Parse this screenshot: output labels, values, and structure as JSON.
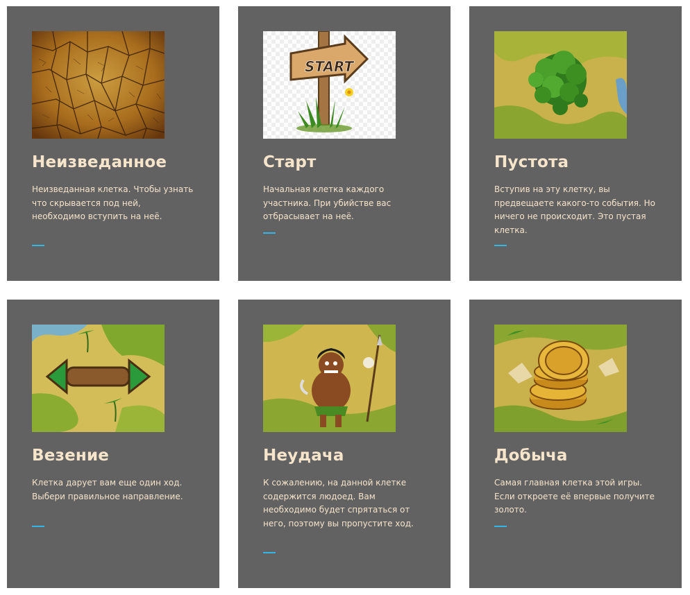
{
  "cards": [
    {
      "title": "Неизведанное",
      "description": "Неизведанная клетка. Чтобы узнать что скрывается под ней, необходимо вступить на неё.",
      "image": "cracked-earth-icon",
      "accent": "#34b7e6"
    },
    {
      "title": "Старт",
      "description": "Начальная клетка каждого участника. При убийстве вас отбрасывает на неё.",
      "image": "start-signpost-icon",
      "sign_text": "START",
      "accent": "#34b7e6"
    },
    {
      "title": "Пустота",
      "description": "Вступив на эту клетку, вы предвещаете какого-то события. Но ничего не происходит. Это пустая клетка.",
      "image": "forest-island-icon",
      "accent": "#34b7e6"
    },
    {
      "title": "Везение",
      "description": "Клетка дарует вам еще один ход. Выбери правильное направление.",
      "image": "arrows-sign-icon",
      "accent": "#34b7e6"
    },
    {
      "title": "Неудача",
      "description": "К сожалению, на данной клетке содержится людоед. Вам необходимо будет спрятаться от него, поэтому вы пропустите ход.",
      "image": "cannibal-icon",
      "accent": "#34b7e6"
    },
    {
      "title": "Добыча",
      "description": "Самая главная клетка этой игры. Если откроете её впервые получите золото.",
      "image": "gold-coins-icon",
      "accent": "#34b7e6"
    }
  ]
}
